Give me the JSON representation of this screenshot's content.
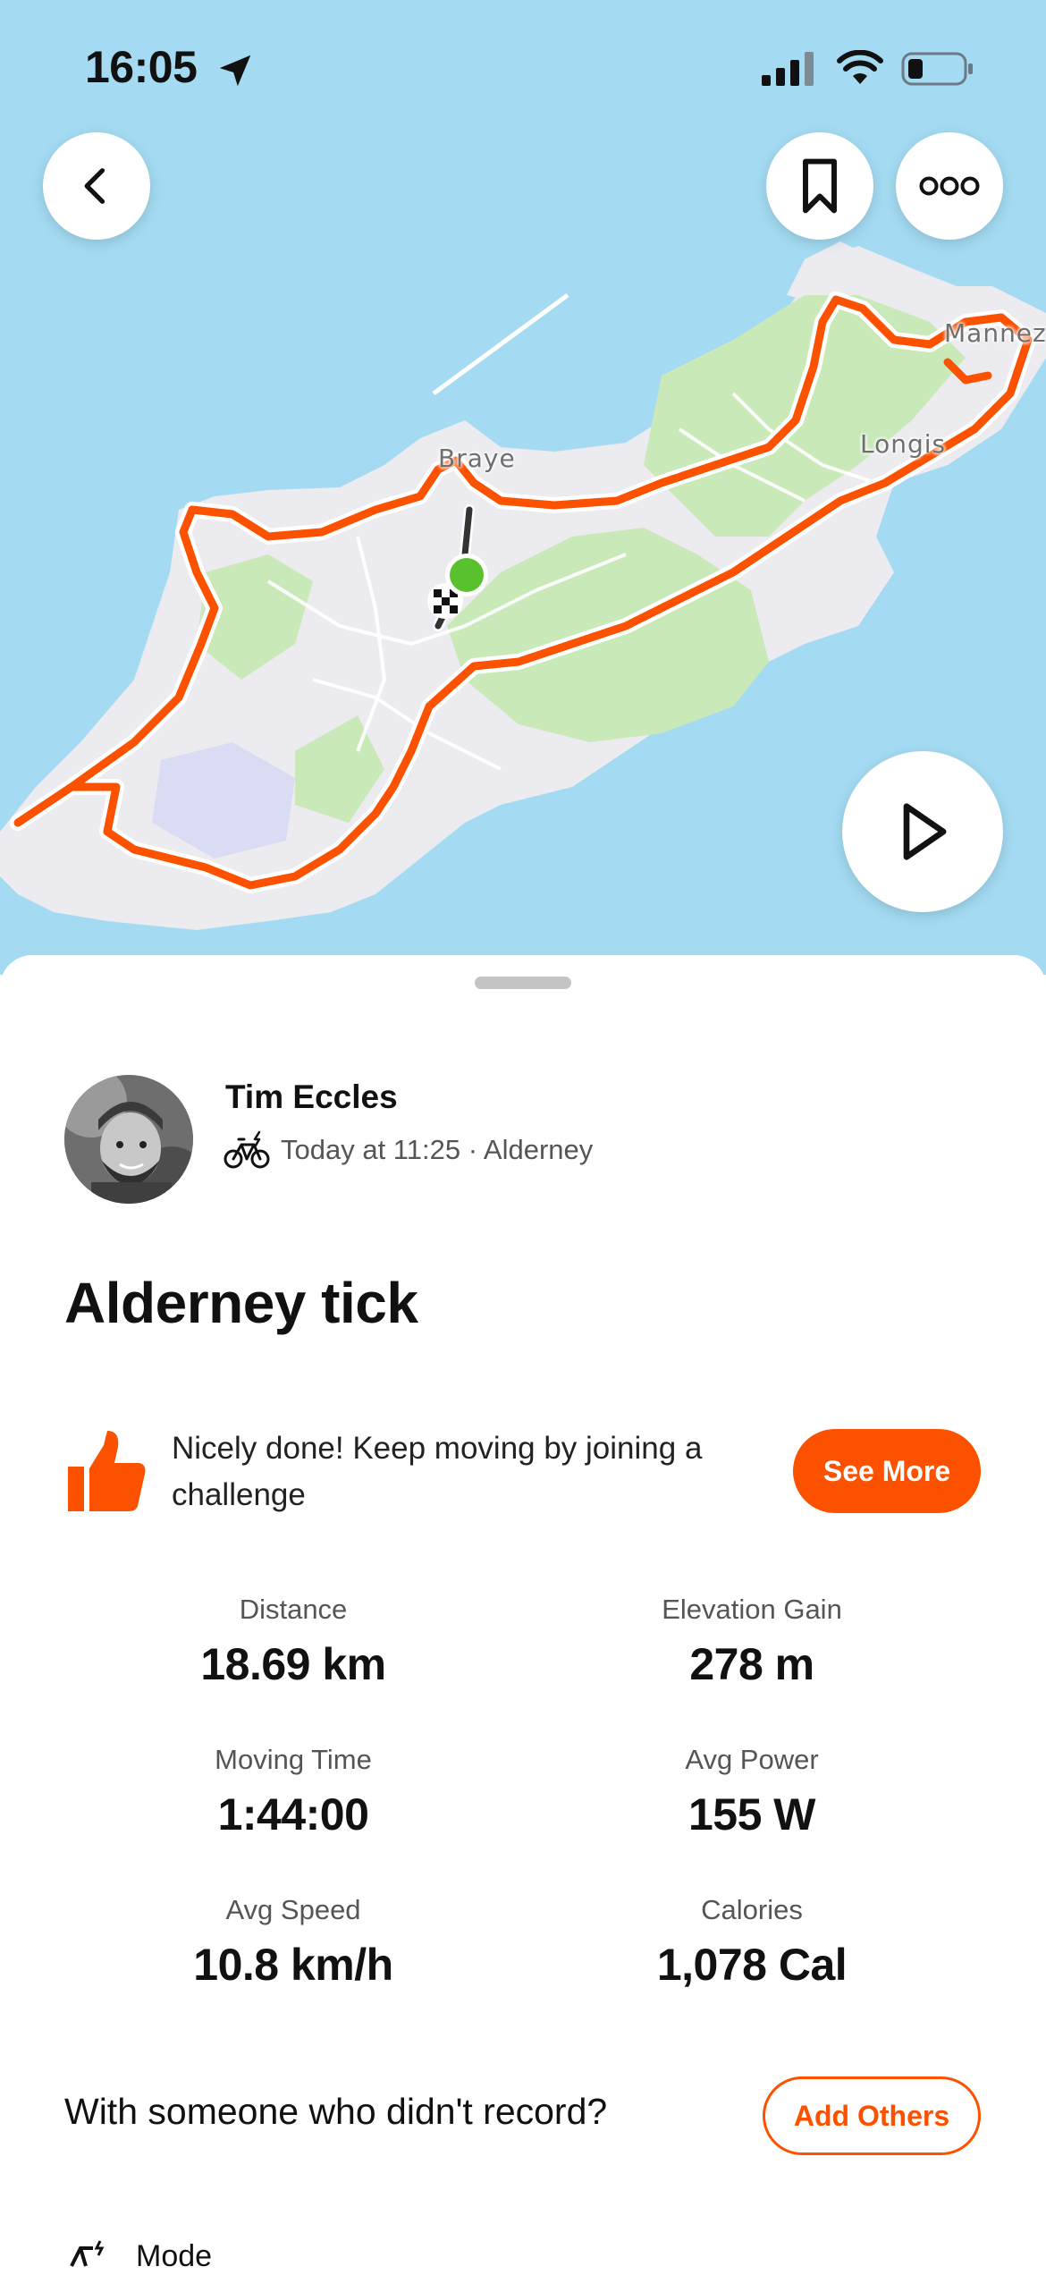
{
  "status_bar": {
    "time": "16:05",
    "icons": [
      "location-arrow-icon",
      "signal-icon",
      "wifi-icon",
      "battery-icon"
    ]
  },
  "map": {
    "labels": {
      "braye": "Braye",
      "longis": "Longis",
      "mannez": "Mannez"
    },
    "route_color": "#fc5200",
    "start_color": "#5ac12e",
    "buttons": [
      "back-icon",
      "bookmark-icon",
      "more-icon",
      "play-icon"
    ]
  },
  "athlete": {
    "name": "Tim Eccles",
    "meta": "Today at 11:25 · Alderney",
    "sport_icon": "e-bike-icon"
  },
  "activity": {
    "title": "Alderney tick"
  },
  "promo": {
    "icon": "thumbs-up-icon",
    "text": "Nicely done! Keep moving by joining a challenge",
    "button": "See More"
  },
  "stats": [
    {
      "label": "Distance",
      "value": "18.69 km"
    },
    {
      "label": "Elevation Gain",
      "value": "278 m"
    },
    {
      "label": "Moving Time",
      "value": "1:44:00"
    },
    {
      "label": "Avg Power",
      "value": "155 W"
    },
    {
      "label": "Avg Speed",
      "value": "10.8 km/h"
    },
    {
      "label": "Calories",
      "value": "1,078 Cal"
    }
  ],
  "others": {
    "text": "With someone who didn't record?",
    "button": "Add Others"
  },
  "next_section": {
    "label": "Mode"
  },
  "colors": {
    "accent": "#fc5200",
    "water": "#a4dbf2",
    "land": "#ecebf0",
    "park": "#c9e9b8"
  }
}
